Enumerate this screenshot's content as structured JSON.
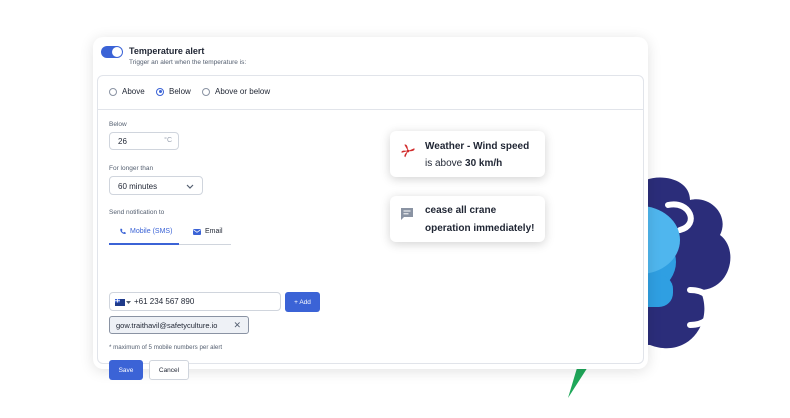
{
  "alert": {
    "title": "Temperature alert",
    "subtitle": "Trigger an alert when the temperature is:",
    "options": [
      "Above",
      "Below",
      "Above or below"
    ],
    "selected_option": "Below",
    "below_label": "Below",
    "below_value": "26",
    "unit": "°C",
    "longer_label": "For longer than",
    "duration_value": "60 minutes",
    "notify_label": "Send notification to",
    "tabs": [
      "Mobile (SMS)",
      "Email"
    ],
    "phone_value": "+61 234 567 890",
    "add_label": "+ Add",
    "chip_text": "gow.traithavil@safetyculture.io",
    "note": "* maximum of 5 mobile numbers per alert",
    "save_label": "Save",
    "cancel_label": "Cancel"
  },
  "weather_callout": {
    "title": "Weather - Wind speed",
    "line_prefix": "is above",
    "line_value": "30 km/h"
  },
  "message_callout": {
    "line1": "cease all crane",
    "line2": "operation immediately!"
  },
  "colors": {
    "accent": "#3b63d6",
    "sun": "#f7c318",
    "cloud": "#2f9fe2",
    "bolt": "#1fa85a",
    "night": "#2b2d7a"
  }
}
